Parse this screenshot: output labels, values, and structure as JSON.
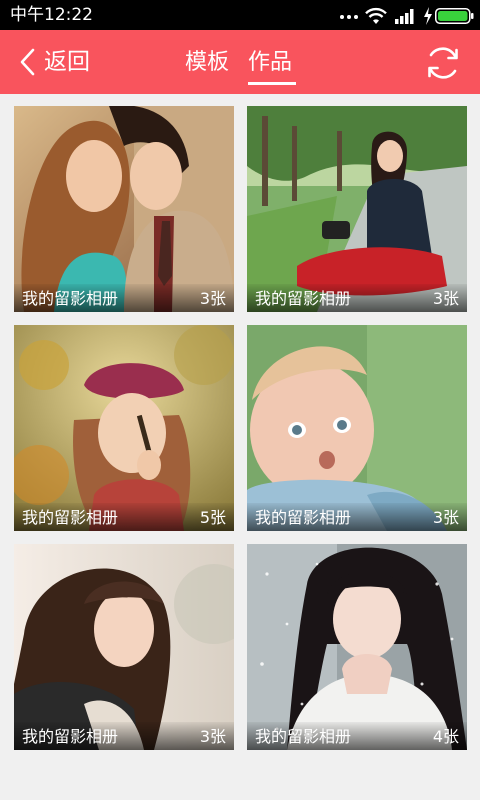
{
  "status_bar": {
    "time": "中午12:22",
    "icons": [
      "more-dots-icon",
      "wifi-icon",
      "signal-icon",
      "charging-bolt-icon",
      "battery-icon"
    ],
    "battery_color": "#39d13c"
  },
  "title_bar": {
    "back_label": "返回",
    "tabs": [
      {
        "label": "模板",
        "selected": false
      },
      {
        "label": "作品",
        "selected": true
      }
    ],
    "refresh_icon": "refresh-icon",
    "color": "#f9545d"
  },
  "albums": [
    {
      "name": "我的留影相册",
      "count": "3张",
      "photo": "couple-photo"
    },
    {
      "name": "我的留影相册",
      "count": "3张",
      "photo": "woman-in-park-photo"
    },
    {
      "name": "我的留影相册",
      "count": "5张",
      "photo": "girl-in-beret-photo"
    },
    {
      "name": "我的留影相册",
      "count": "3张",
      "photo": "baby-photo"
    },
    {
      "name": "我的留影相册",
      "count": "3张",
      "photo": "woman-portrait-photo"
    },
    {
      "name": "我的留影相册",
      "count": "4张",
      "photo": "woman-in-snow-photo"
    }
  ]
}
